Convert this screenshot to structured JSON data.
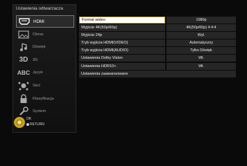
{
  "panel": {
    "title": "Ustawienia odtwarzacza"
  },
  "nav": {
    "items": [
      {
        "label": "HDMI",
        "icon": "hdmi-icon",
        "active": true
      },
      {
        "label": "Obraz",
        "icon": "picture-icon",
        "active": false
      },
      {
        "label": "Dźwięk",
        "icon": "music-note-icon",
        "active": false
      },
      {
        "label": "3D",
        "icon": "3d-icon",
        "active": false
      },
      {
        "label": "Język",
        "icon": "language-abc-icon",
        "active": false
      },
      {
        "label": "Sieć",
        "icon": "network-icon",
        "active": false
      },
      {
        "label": "Klasyfikacja",
        "icon": "lock-icon",
        "active": false
      },
      {
        "label": "System",
        "icon": "wrench-icon",
        "active": false
      }
    ]
  },
  "footer": {
    "ok_label": "OK",
    "return_label": "RETURN"
  },
  "settings": [
    {
      "name": "Format wideo",
      "value": "1080p",
      "selected": true
    },
    {
      "name": "Wyjście 4K(50p/60p)",
      "value": "4K(50p/60p) 4:4:4"
    },
    {
      "name": "Wyjście 24p",
      "value": "Wył."
    },
    {
      "name": "Tryb wyjścia HDMI(VIDEO)",
      "value": "Automatyczny"
    },
    {
      "name": "Tryb wyjścia HDMI(AUDIO)",
      "value": "Tylko Dźwięk"
    },
    {
      "name": "Ustawienia Dolby Vision",
      "value": "Wł."
    },
    {
      "name": "Ustawienia HDR10+",
      "value": "Wł."
    },
    {
      "name": "Ustawienia zaawansowane",
      "value": null
    }
  ],
  "colors": {
    "highlight_border": "#c9a31c",
    "row_bg": "#262626",
    "panel_bg": "#1c1c1c"
  }
}
